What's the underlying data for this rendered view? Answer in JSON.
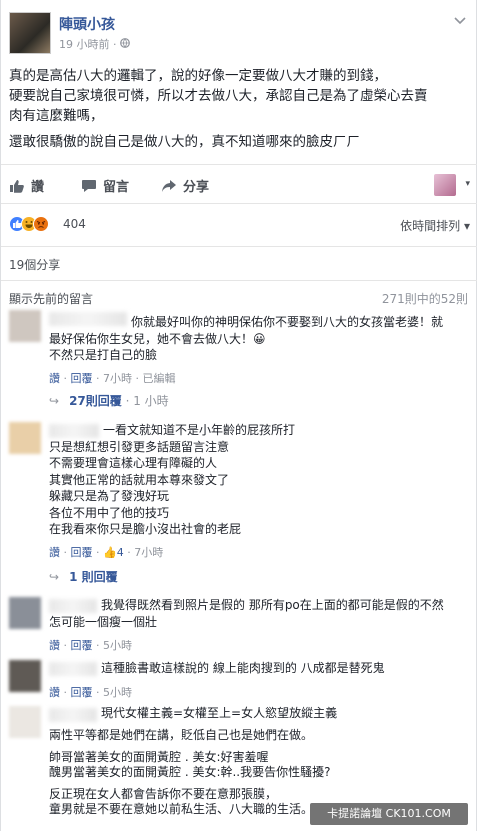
{
  "post": {
    "author": "陣頭小孩",
    "time": "19 小時前",
    "privacy_icon": "globe-icon",
    "menu_icon": "chevron-down-icon",
    "lines": [
      "真的是高估八大的邏輯了，說的好像一定要做八大才賺的到錢，",
      "硬要說自己家境很可憐，所以才去做八大，承認自己是為了虛榮心去賣",
      "肉有這麼難嗎，",
      "還敢很驕傲的說自己是做八大的，真不知道哪來的臉皮ㄏㄏ"
    ]
  },
  "actions": {
    "like": "讚",
    "comment": "留言",
    "share": "分享"
  },
  "reactions": {
    "count": "404",
    "icons": [
      "like-icon",
      "haha-icon",
      "angry-icon"
    ],
    "sort_label": "依時間排列 ▾"
  },
  "shares_label": "19個分享",
  "comments_header": {
    "previous": "顯示先前的留言",
    "count": "271則中的52則"
  },
  "comments": [
    {
      "lines": [
        "你就最好叫你的神明保佑你不要娶到八大的女孩當老婆！就",
        "最好保佑你生女兒，她不會去做八大！😀",
        "不然只是打自己的臉"
      ],
      "like": "讚",
      "reply": "回覆",
      "time": "7小時",
      "extra": "已編輯",
      "replies": "27則回覆",
      "replies_time": "1 小時"
    },
    {
      "lines": [
        "一看文就知道不是小年齡的屁孩所打",
        "只是想紅想引發更多話題留言注意",
        "不需要理會這樣心理有障礙的人",
        "其實他正常的話就用本尊來發文了",
        "躲藏只是為了發洩好玩",
        "各位不用中了他的技巧",
        "在我看來你只是膽小沒出社會的老屁"
      ],
      "like": "讚",
      "reply": "回覆",
      "likes": "4",
      "time": "7小時",
      "replies": "1 則回覆"
    },
    {
      "lines": [
        "我覺得既然看到照片是假的 那所有po在上面的都可能是假的不然",
        "怎可能一個瘦一個壯"
      ],
      "like": "讚",
      "reply": "回覆",
      "time": "5小時"
    },
    {
      "lines": [
        "這種臉書敢這樣說的 線上能肉搜到的 八成都是替死鬼"
      ],
      "like": "讚",
      "reply": "回覆",
      "time": "5小時"
    },
    {
      "lines": [
        "現代女權主義=女權至上=女人慾望放縱主義",
        "",
        "兩性平等都是她們在講，貶低自己也是她們在做。",
        "",
        "帥哥當著美女的面開黃腔 . 美女:好害羞喔",
        "醜男當著美女的面開黃腔 . 美女:幹..我要告你性騷擾?",
        "",
        "反正現在女人都會告訴你不要在意那張膜，",
        "童男就是不要在意她以前私生活、八大職的生活。"
      ]
    }
  ],
  "watermark": "卡提諾論壇 CK101.COM"
}
